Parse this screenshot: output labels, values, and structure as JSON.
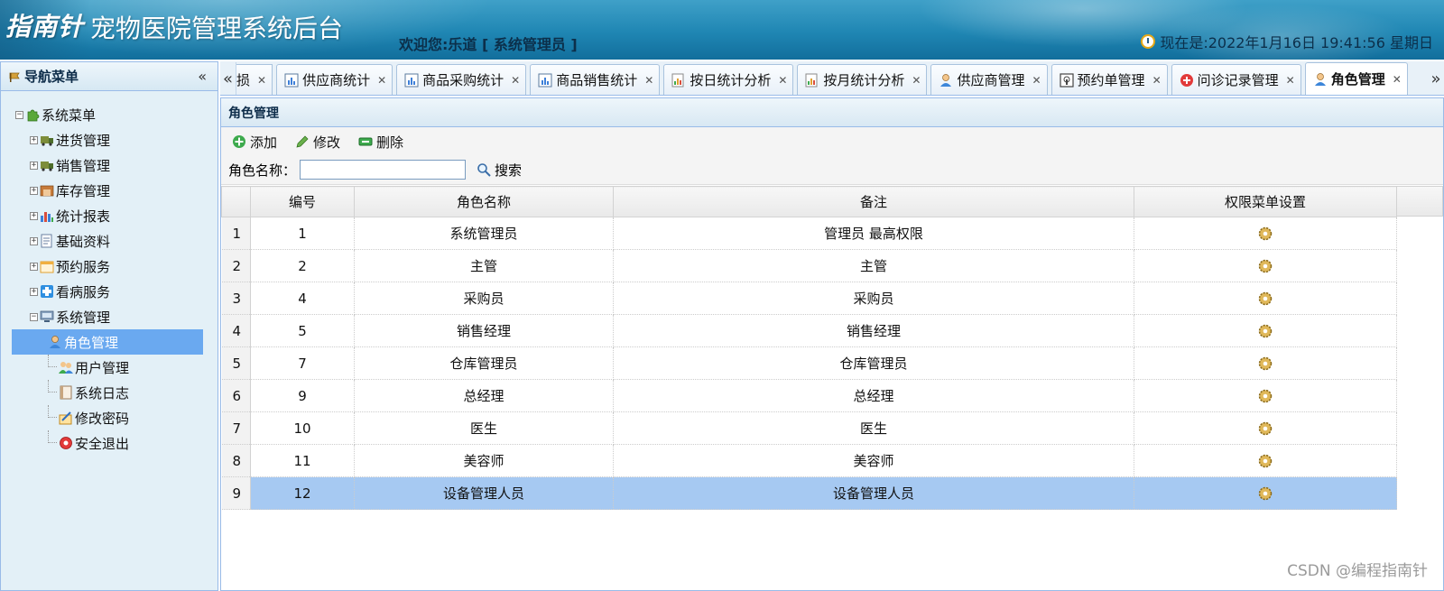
{
  "header": {
    "logo": "指南针",
    "title": "宠物医院管理系统后台",
    "welcome": "欢迎您:乐道 [ 系统管理员 ]",
    "clock": "现在是:2022年1月16日 19:41:56 星期日"
  },
  "sidebar": {
    "title": "导航菜单",
    "collapse": "«",
    "root": "系统菜单",
    "groups": [
      {
        "label": "进货管理",
        "icon": "truck-icon"
      },
      {
        "label": "销售管理",
        "icon": "truck-icon"
      },
      {
        "label": "库存管理",
        "icon": "warehouse-icon"
      },
      {
        "label": "统计报表",
        "icon": "bar-chart-icon"
      },
      {
        "label": "基础资料",
        "icon": "document-icon"
      },
      {
        "label": "预约服务",
        "icon": "calendar-icon"
      },
      {
        "label": "看病服务",
        "icon": "medical-cross-icon"
      },
      {
        "label": "系统管理",
        "icon": "computer-icon"
      }
    ],
    "sub_items": [
      {
        "label": "角色管理",
        "icon": "user-icon"
      },
      {
        "label": "用户管理",
        "icon": "users-icon"
      },
      {
        "label": "系统日志",
        "icon": "log-icon"
      },
      {
        "label": "修改密码",
        "icon": "password-icon"
      },
      {
        "label": "安全退出",
        "icon": "exit-icon"
      }
    ]
  },
  "tabs": {
    "scroll_left": "«",
    "scroll_right": "»",
    "items": [
      {
        "label": "损"
      },
      {
        "label": "供应商统计"
      },
      {
        "label": "商品采购统计"
      },
      {
        "label": "商品销售统计"
      },
      {
        "label": "按日统计分析"
      },
      {
        "label": "按月统计分析"
      },
      {
        "label": "供应商管理"
      },
      {
        "label": "预约单管理"
      },
      {
        "label": "问诊记录管理"
      },
      {
        "label": "角色管理"
      }
    ]
  },
  "panel": {
    "title": "角色管理",
    "toolbar": {
      "add": "添加",
      "edit": "修改",
      "delete": "删除"
    },
    "search": {
      "label": "角色名称：",
      "value": "",
      "button": "搜索"
    }
  },
  "grid": {
    "columns": [
      "编号",
      "角色名称",
      "备注",
      "权限菜单设置"
    ],
    "rows": [
      {
        "n": "1",
        "id": "1",
        "name": "系统管理员",
        "remark": "管理员 最高权限"
      },
      {
        "n": "2",
        "id": "2",
        "name": "主管",
        "remark": "主管"
      },
      {
        "n": "3",
        "id": "4",
        "name": "采购员",
        "remark": "采购员"
      },
      {
        "n": "4",
        "id": "5",
        "name": "销售经理",
        "remark": "销售经理"
      },
      {
        "n": "5",
        "id": "7",
        "name": "仓库管理员",
        "remark": "仓库管理员"
      },
      {
        "n": "6",
        "id": "9",
        "name": "总经理",
        "remark": "总经理"
      },
      {
        "n": "7",
        "id": "10",
        "name": "医生",
        "remark": "医生"
      },
      {
        "n": "8",
        "id": "11",
        "name": "美容师",
        "remark": "美容师"
      },
      {
        "n": "9",
        "id": "12",
        "name": "设备管理人员",
        "remark": "设备管理人员"
      }
    ],
    "selected_row": 9
  },
  "watermark": "CSDN @编程指南针",
  "colors": {
    "header": "#1f86b3",
    "selected_row": "#a6c9f2",
    "selected_tree": "#6aa9f0"
  }
}
